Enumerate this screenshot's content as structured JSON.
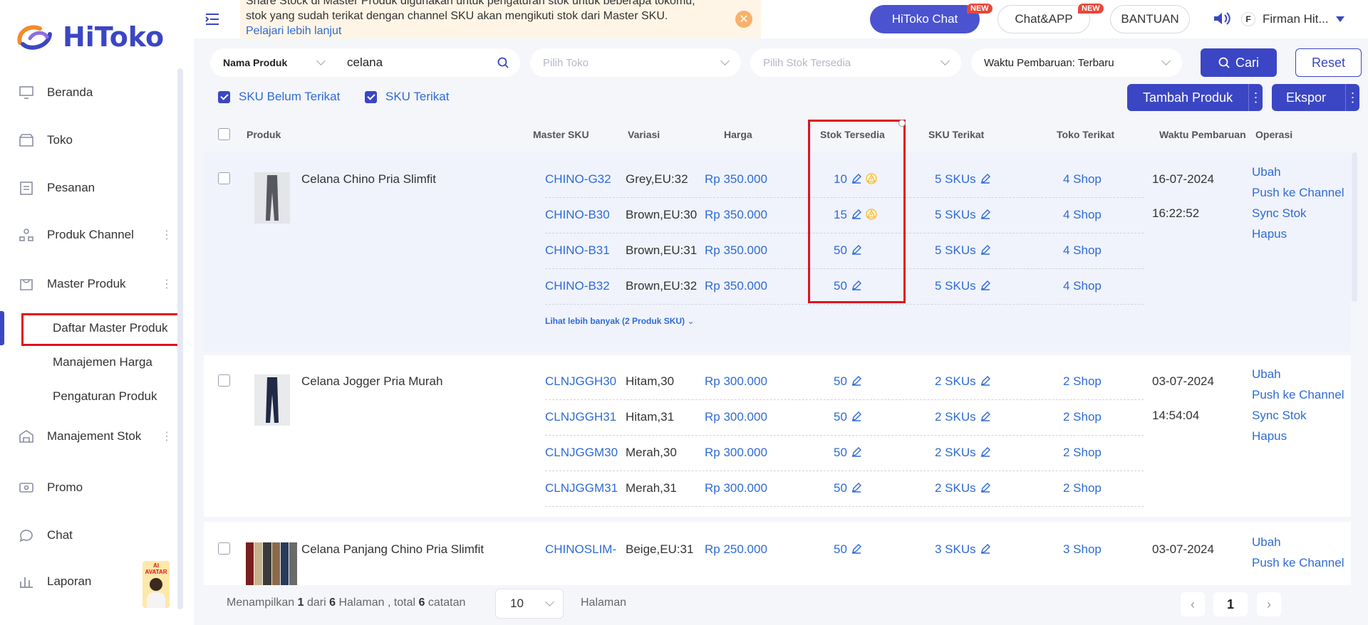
{
  "brand": {
    "name": "HiToko"
  },
  "sidebar": {
    "items": [
      {
        "label": "Beranda"
      },
      {
        "label": "Toko"
      },
      {
        "label": "Pesanan"
      },
      {
        "label": "Produk Channel"
      },
      {
        "label": "Master Produk"
      },
      {
        "label": "Manajement Stok"
      },
      {
        "label": "Promo"
      },
      {
        "label": "Chat"
      },
      {
        "label": "Laporan"
      }
    ],
    "sub_items": [
      {
        "label": "Daftar Master Produk"
      },
      {
        "label": "Manajemen Harga"
      },
      {
        "label": "Pengaturan Produk"
      }
    ],
    "avatar_badge": "AI AVATAR"
  },
  "banner": {
    "line1": "Share Stock di Master Produk digunakan untuk pengaturan stok untuk beberapa tokomu,",
    "line2": "stok yang sudah terikat dengan channel SKU akan mengikuti stok dari Master SKU.",
    "link": "Pelajari lebih lanjut"
  },
  "topbar": {
    "hitoko_chat": "HiToko Chat",
    "chat_app": "Chat&APP",
    "new_badge": "NEW",
    "bantuan": "BANTUAN",
    "user": "Firman Hit..."
  },
  "filters": {
    "search_type": "Nama Produk",
    "search_value": "celana",
    "toko_placeholder": "Pilih Toko",
    "stok_placeholder": "Pilih Stok Tersedia",
    "sort": "Waktu Pembaruan: Terbaru",
    "search_button": "Cari",
    "reset_button": "Reset",
    "sku_unbound": "SKU Belum Terikat",
    "sku_bound": "SKU Terikat",
    "add_product": "Tambah Produk",
    "export": "Ekspor"
  },
  "table": {
    "headers": [
      "Produk",
      "Master SKU",
      "Variasi",
      "Harga",
      "Stok Tersedia",
      "SKU Terikat",
      "Toko Terikat",
      "Waktu Pembaruan",
      "Operasi"
    ],
    "operations": [
      "Ubah",
      "Push ke Channel",
      "Sync Stok",
      "Hapus"
    ],
    "products": [
      {
        "name": "Celana Chino Pria Slimfit",
        "date": "16-07-2024",
        "time": "16:22:52",
        "more": "Lihat lebih banyak (2 Produk SKU)",
        "skus": [
          {
            "sku": "CHINO-G32",
            "variasi": "Grey,EU:32",
            "harga": "Rp 350.000",
            "stok": "10",
            "sku_terikat": "5 SKUs",
            "toko": "4 Shop",
            "warn": true
          },
          {
            "sku": "CHINO-B30",
            "variasi": "Brown,EU:30",
            "harga": "Rp 350.000",
            "stok": "15",
            "sku_terikat": "5 SKUs",
            "toko": "4 Shop",
            "warn": true
          },
          {
            "sku": "CHINO-B31",
            "variasi": "Brown,EU:31",
            "harga": "Rp 350.000",
            "stok": "50",
            "sku_terikat": "5 SKUs",
            "toko": "4 Shop",
            "warn": false
          },
          {
            "sku": "CHINO-B32",
            "variasi": "Brown,EU:32",
            "harga": "Rp 350.000",
            "stok": "50",
            "sku_terikat": "5 SKUs",
            "toko": "4 Shop",
            "warn": false
          }
        ]
      },
      {
        "name": "Celana Jogger Pria Murah",
        "date": "03-07-2024",
        "time": "14:54:04",
        "skus": [
          {
            "sku": "CLNJGGH30",
            "variasi": "Hitam,30",
            "harga": "Rp 300.000",
            "stok": "50",
            "sku_terikat": "2 SKUs",
            "toko": "2 Shop"
          },
          {
            "sku": "CLNJGGH31",
            "variasi": "Hitam,31",
            "harga": "Rp 300.000",
            "stok": "50",
            "sku_terikat": "2 SKUs",
            "toko": "2 Shop"
          },
          {
            "sku": "CLNJGGM30",
            "variasi": "Merah,30",
            "harga": "Rp 300.000",
            "stok": "50",
            "sku_terikat": "2 SKUs",
            "toko": "2 Shop"
          },
          {
            "sku": "CLNJGGM31",
            "variasi": "Merah,31",
            "harga": "Rp 300.000",
            "stok": "50",
            "sku_terikat": "2 SKUs",
            "toko": "2 Shop"
          }
        ]
      },
      {
        "name": "Celana Panjang Chino Pria Slimfit",
        "date": "03-07-2024",
        "skus": [
          {
            "sku": "CHINOSLIM-",
            "variasi": "Beige,EU:31",
            "harga": "Rp 250.000",
            "stok": "50",
            "sku_terikat": "3 SKUs",
            "toko": "3 Shop"
          }
        ]
      }
    ]
  },
  "footer": {
    "prefix": "Menampilkan",
    "current": "1",
    "of": "dari",
    "total_pages": "6",
    "pages_word": "Halaman , total",
    "total_records": "6",
    "records_word": "catatan",
    "page_size": "10",
    "halaman": "Halaman",
    "page": "1"
  },
  "colors": {
    "accent": "#3b46c4",
    "link": "#2e6bd6",
    "highlight": "#e0101e",
    "warn": "#f5b82e"
  }
}
